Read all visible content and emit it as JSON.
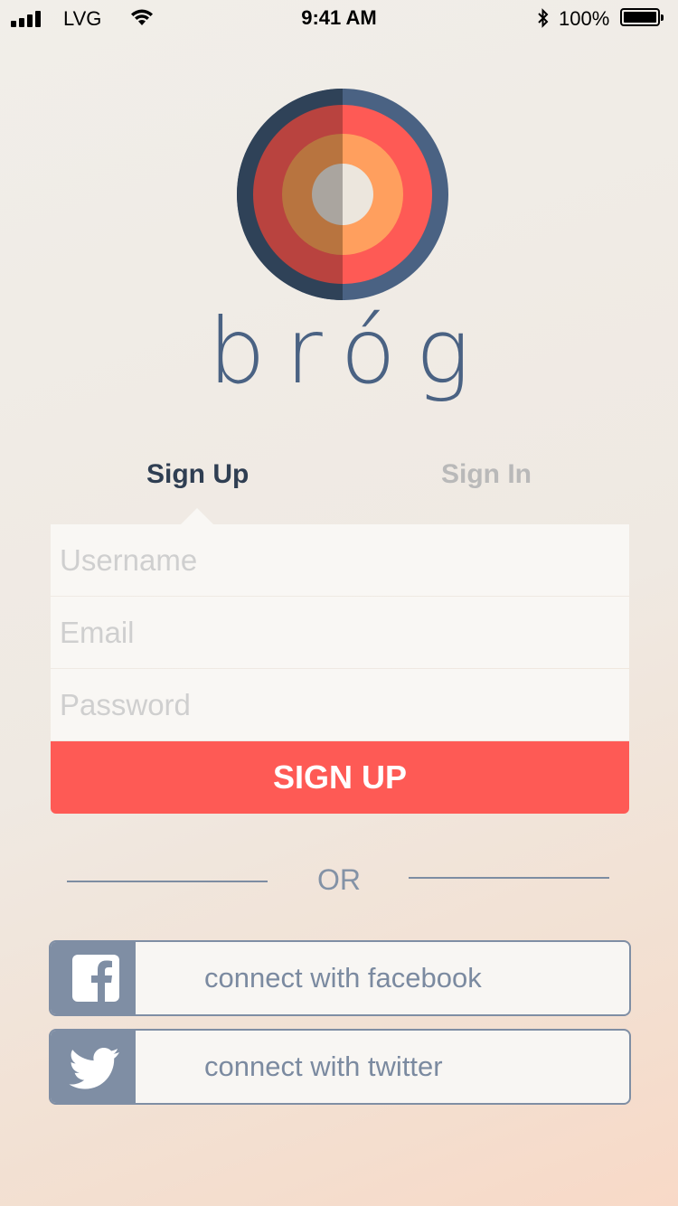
{
  "status_bar": {
    "carrier": "LVG",
    "time": "9:41 AM",
    "battery_percent": "100%"
  },
  "brand": {
    "name": "bróg",
    "logo_colors": {
      "outer_ring": "#2f4258",
      "red_ring": "#fe5a55",
      "orange_ring": "#ff9f5e",
      "center": "#ece6dd",
      "text": "#4a6283"
    }
  },
  "tabs": [
    {
      "label": "Sign Up",
      "active": true
    },
    {
      "label": "Sign In",
      "active": false
    }
  ],
  "form": {
    "username_placeholder": "Username",
    "email_placeholder": "Email",
    "password_placeholder": "Password",
    "submit_label": "SIGN UP",
    "submit_color": "#fe5a55"
  },
  "divider_text": "OR",
  "social": {
    "facebook_label": "connect with facebook",
    "facebook_icon": "facebook-icon",
    "twitter_label": "connect with twitter",
    "twitter_icon": "twitter-icon"
  }
}
